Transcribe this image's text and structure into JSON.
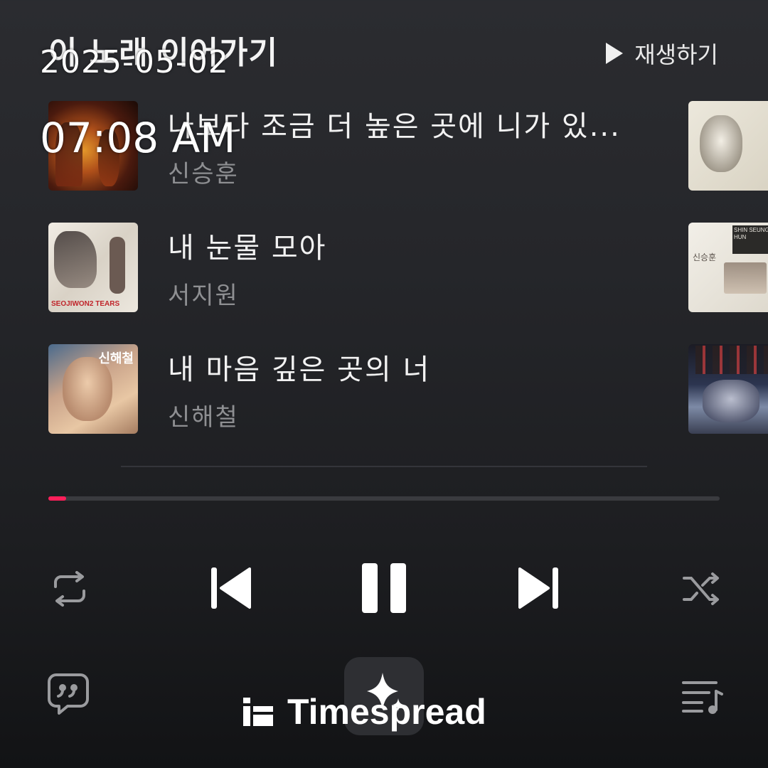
{
  "header": {
    "title": "이 노래 이어가기",
    "play_all_label": "재생하기"
  },
  "tracks": [
    {
      "title": "나보다 조금 더 높은 곳에 니가 있...",
      "artist": "신승훈",
      "cover_icon": "album-cover"
    },
    {
      "title": "내 눈물 모아",
      "artist": "서지원",
      "cover_text": "SEOJIWON2 TEARS"
    },
    {
      "title": "내 마음 깊은 곳의 너",
      "artist": "신해철",
      "cover_text": "신해철"
    }
  ],
  "side_covers": [
    {
      "cover_icon": "album-cover"
    },
    {
      "cover_text": "SHIN SEUNG HUN",
      "cover_sub": "신승훈"
    },
    {
      "cover_icon": "album-cover"
    }
  ],
  "player": {
    "progress": 0.027,
    "accent_color": "#ff1f5a",
    "controls": [
      "repeat-icon",
      "previous-icon",
      "pause-icon",
      "next-icon",
      "shuffle-icon"
    ],
    "bottom": [
      "lyrics-icon",
      "ai-sparkle-icon",
      "playlist-icon"
    ]
  },
  "overlay": {
    "date": "2025-05-02",
    "time": "07:08 AM",
    "watermark": "Timespread"
  }
}
